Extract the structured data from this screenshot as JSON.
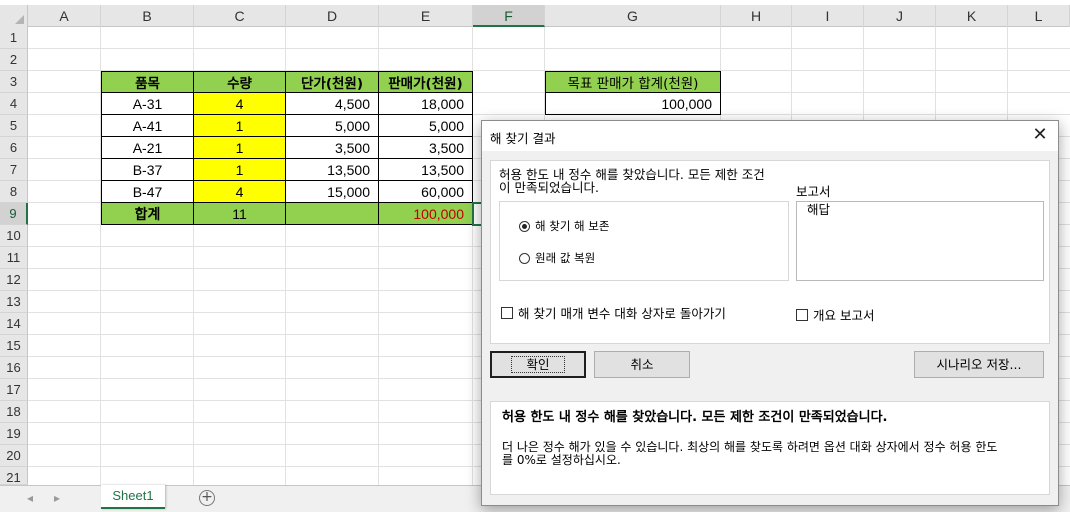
{
  "sheet": {
    "columns": [
      "A",
      "B",
      "C",
      "D",
      "E",
      "F",
      "G",
      "H",
      "I",
      "J",
      "K",
      "L"
    ],
    "selected_column": "F",
    "rows": [
      "1",
      "2",
      "3",
      "4",
      "5",
      "6",
      "7",
      "8",
      "9",
      "10",
      "11",
      "12",
      "13",
      "14",
      "15",
      "16",
      "17",
      "18",
      "19",
      "20",
      "21"
    ],
    "selected_row": "9",
    "table": {
      "headers": [
        "품목",
        "수량",
        "단가(천원)",
        "판매가(천원)"
      ],
      "rows": [
        [
          "A-31",
          "4",
          "4,500",
          "18,000"
        ],
        [
          "A-41",
          "1",
          "5,000",
          "5,000"
        ],
        [
          "A-21",
          "1",
          "3,500",
          "3,500"
        ],
        [
          "B-37",
          "1",
          "13,500",
          "13,500"
        ],
        [
          "B-47",
          "4",
          "15,000",
          "60,000"
        ]
      ],
      "total": {
        "label": "합계",
        "qty": "11",
        "price": "",
        "sale": "100,000"
      }
    },
    "target": {
      "header": "목표 판매가 합계(천원)",
      "value": "100,000"
    },
    "tab_name": "Sheet1",
    "add_sheet_symbol": "+",
    "nav_prev": "◂",
    "nav_next": "▸",
    "colors": {
      "header_green": "#92d050",
      "input_yellow": "#ffff00",
      "total_red": "#c00000",
      "excel_green": "#217346"
    }
  },
  "dialog": {
    "title": "해 찾기 결과",
    "close_symbol": "✕",
    "message_line1": "허용 한도 내 정수 해를 찾았습니다. 모든 제한 조건",
    "message_line2": "이 만족되었습니다.",
    "keep_solution": "해 찾기 해 보존",
    "restore_values": "원래 값 복원",
    "reports_label": "보고서",
    "reports_items": [
      "해답"
    ],
    "return_to_params": "해 찾기 매개 변수 대화 상자로 돌아가기",
    "outline_reports": "개요 보고서",
    "ok": "확인",
    "cancel": "취소",
    "save_scenario": "시나리오 저장...",
    "info_title": "허용 한도 내 정수 해를 찾았습니다. 모든 제한 조건이 만족되었습니다.",
    "info_body_line1": "더 나은 정수 해가 있을 수 있습니다. 최상의 해를 찾도록 하려면 옵션 대화 상자에서 정수 허용 한도",
    "info_body_line2": "를 0%로 설정하십시오."
  }
}
